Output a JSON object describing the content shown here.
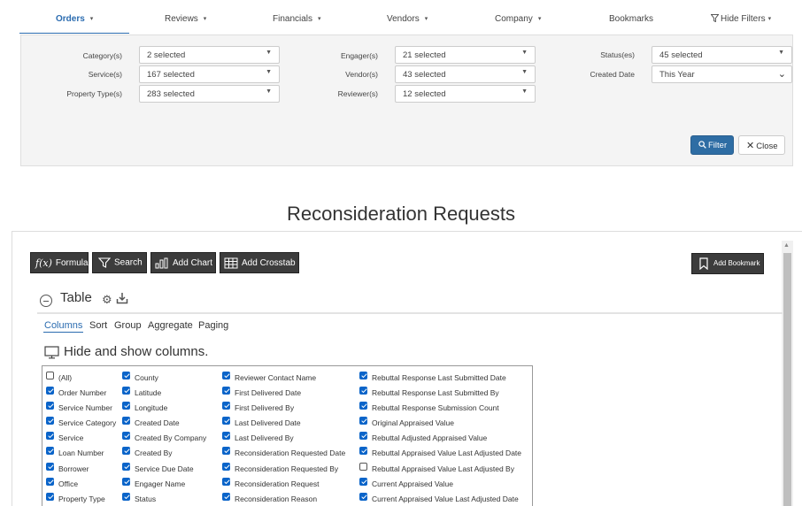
{
  "nav": {
    "items": [
      {
        "label": "Orders",
        "caret": "▾",
        "active": true
      },
      {
        "label": "Reviews",
        "caret": "▾"
      },
      {
        "label": "Financials",
        "caret": "▾"
      },
      {
        "label": "Vendors",
        "caret": "▾"
      },
      {
        "label": "Company",
        "caret": "▾"
      },
      {
        "label": "Bookmarks",
        "caret": ""
      },
      {
        "label": "Hide Filters",
        "caret": "▾"
      }
    ]
  },
  "filters": {
    "category": {
      "label": "Category(s)",
      "value": "2 selected"
    },
    "service": {
      "label": "Service(s)",
      "value": "167 selected"
    },
    "property_type": {
      "label": "Property Type(s)",
      "value": "283 selected"
    },
    "engager": {
      "label": "Engager(s)",
      "value": "21 selected"
    },
    "vendor": {
      "label": "Vendor(s)",
      "value": "43 selected"
    },
    "reviewer": {
      "label": "Reviewer(s)",
      "value": "12 selected"
    },
    "status": {
      "label": "Status(es)",
      "value": "45 selected"
    },
    "created_date": {
      "label": "Created Date",
      "value": "This Year"
    },
    "filter_button": "Filter",
    "close_button": "Close"
  },
  "page_title": "Reconsideration Requests",
  "toolbar": {
    "formula": "Formula",
    "formula_icon": "f(x)",
    "search": "Search",
    "add_chart": "Add Chart",
    "add_crosstab": "Add Crosstab",
    "add_bookmark": "Add Bookmark"
  },
  "table_section": {
    "title": "Table",
    "tabs": [
      "Columns",
      "Sort",
      "Group",
      "Aggregate",
      "Paging"
    ],
    "active_tab": "Columns",
    "columns_title": "Hide and show columns."
  },
  "columns": [
    [
      {
        "label": "(All)",
        "checked": false
      },
      {
        "label": "Order Number",
        "checked": true
      },
      {
        "label": "Service Number",
        "checked": true
      },
      {
        "label": "Service Category",
        "checked": true
      },
      {
        "label": "Service",
        "checked": true
      },
      {
        "label": "Loan Number",
        "checked": true
      },
      {
        "label": "Borrower",
        "checked": true
      },
      {
        "label": "Office",
        "checked": true
      },
      {
        "label": "Property Type",
        "checked": true
      }
    ],
    [
      {
        "label": "County",
        "checked": true
      },
      {
        "label": "Latitude",
        "checked": true
      },
      {
        "label": "Longitude",
        "checked": true
      },
      {
        "label": "Created Date",
        "checked": true
      },
      {
        "label": "Created By Company",
        "checked": true
      },
      {
        "label": "Created By",
        "checked": true
      },
      {
        "label": "Service Due Date",
        "checked": true
      },
      {
        "label": "Engager Name",
        "checked": true
      },
      {
        "label": "Status",
        "checked": true
      }
    ],
    [
      {
        "label": "Reviewer Contact Name",
        "checked": true
      },
      {
        "label": "First Delivered Date",
        "checked": true
      },
      {
        "label": "First Delivered By",
        "checked": true
      },
      {
        "label": "Last Delivered Date",
        "checked": true
      },
      {
        "label": "Last Delivered By",
        "checked": true
      },
      {
        "label": "Reconsideration Requested Date",
        "checked": true
      },
      {
        "label": "Reconsideration Requested By",
        "checked": true
      },
      {
        "label": "Reconsideration Request",
        "checked": true
      },
      {
        "label": "Reconsideration Reason",
        "checked": true
      }
    ],
    [
      {
        "label": "Rebuttal Response Last Submitted Date",
        "checked": true
      },
      {
        "label": "Rebuttal Response Last Submitted By",
        "checked": true
      },
      {
        "label": "Rebuttal Response Submission Count",
        "checked": true
      },
      {
        "label": "Original Appraised Value",
        "checked": true
      },
      {
        "label": "Rebuttal Adjusted Appraised Value",
        "checked": true
      },
      {
        "label": "Rebuttal Appraised Value Last Adjusted Date",
        "checked": true
      },
      {
        "label": "Rebuttal Appraised Value Last Adjusted By",
        "checked": false
      },
      {
        "label": "Current Appraised Value",
        "checked": true
      },
      {
        "label": "Current Appraised Value Last Adjusted Date",
        "checked": true
      }
    ]
  ],
  "colors": {
    "accent": "#2b6cb0",
    "toolbar_bg": "#3c3c3c",
    "filter_button": "#2e6da4",
    "checkbox": "#0a64c9"
  }
}
